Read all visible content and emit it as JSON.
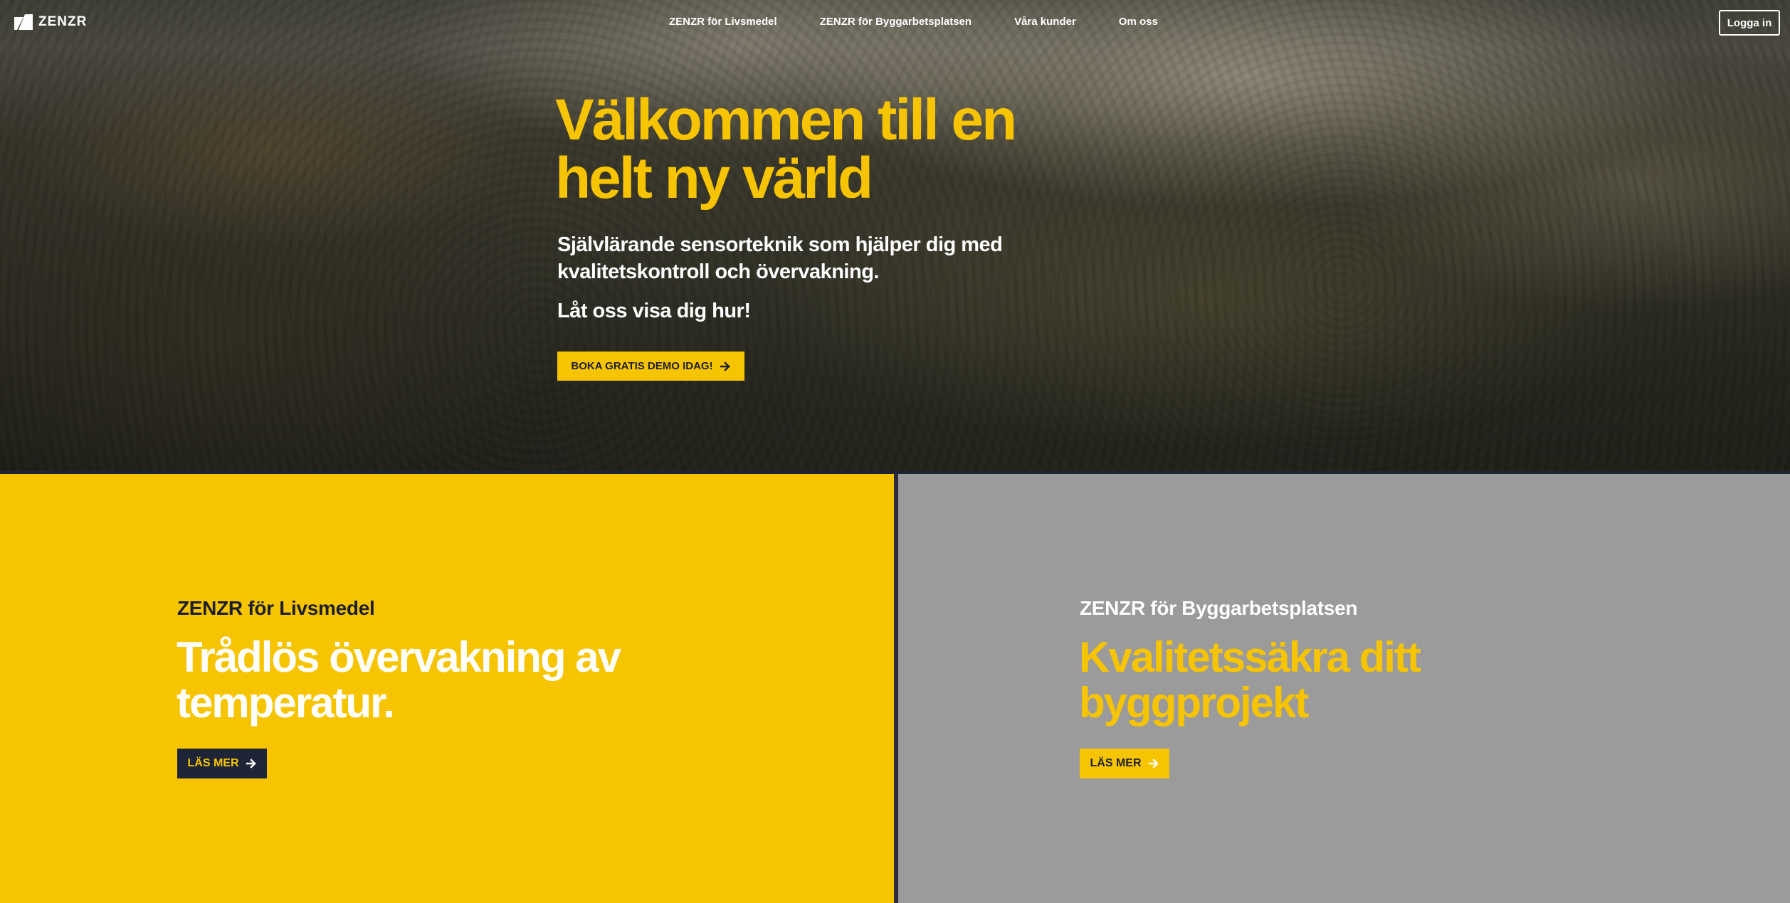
{
  "brand": {
    "name": "ZENZR",
    "accent_color": "#f7c402",
    "dark_color": "#1d2536"
  },
  "nav": {
    "links": [
      {
        "label": "ZENZR för Livsmedel"
      },
      {
        "label": "ZENZR för Byggarbetsplatsen"
      },
      {
        "label": "Våra kunder"
      },
      {
        "label": "Om oss"
      }
    ],
    "login_label": "Logga in"
  },
  "hero": {
    "title": "Välkommen till en helt ny värld",
    "subtitle": "Självlärande sensorteknik som hjälper dig med kvalitetskontroll och övervakning.",
    "subtitle2": "Låt oss visa dig hur!",
    "cta_label": "BOKA GRATIS DEMO IDAG!"
  },
  "panels": {
    "left": {
      "kicker": "ZENZR för Livsmedel",
      "title": "Trådlös övervakning av temperatur.",
      "button_label": "LÄS MER",
      "background": "#f7c402"
    },
    "right": {
      "kicker": "ZENZR för Byggarbetsplatsen",
      "title": "Kvalitetssäkra ditt byggprojekt",
      "button_label": "LÄS MER",
      "background": "#9b9b9b"
    }
  }
}
